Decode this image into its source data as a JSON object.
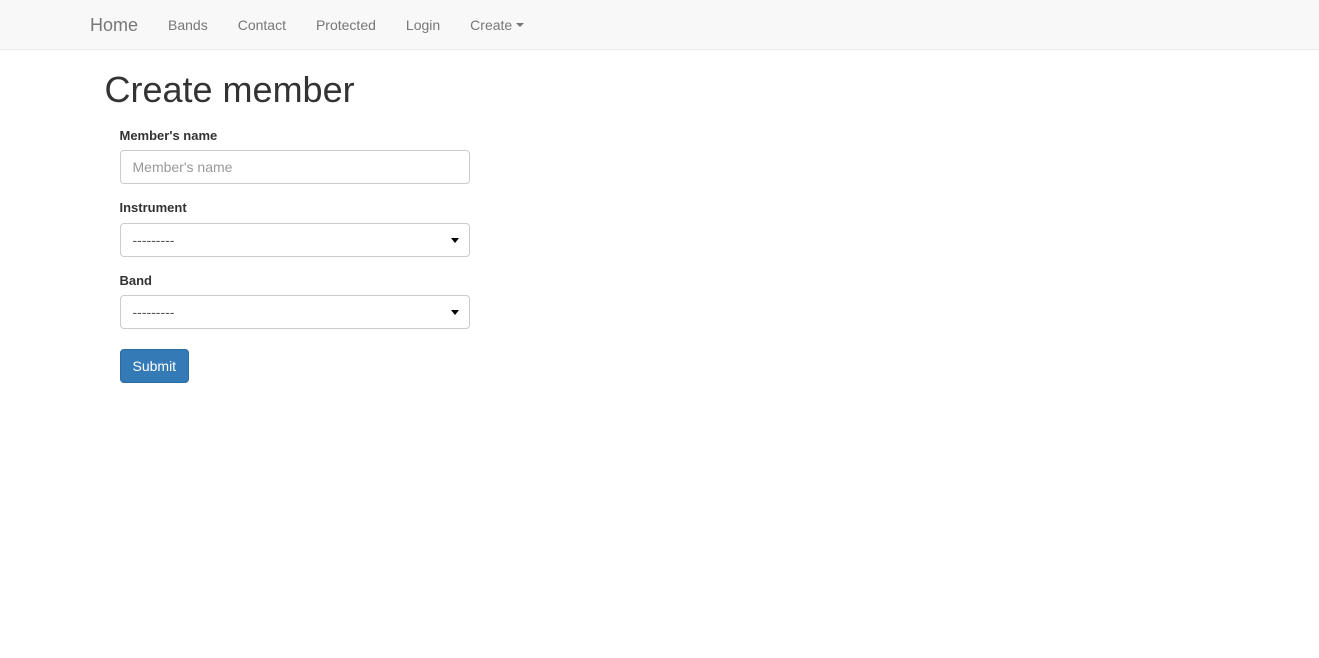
{
  "navbar": {
    "brand": {
      "label": "Home",
      "name": "navbar-brand-home"
    },
    "items": [
      {
        "label": "Bands",
        "name": "nav-item-bands",
        "caret": false
      },
      {
        "label": "Contact",
        "name": "nav-item-contact",
        "caret": false
      },
      {
        "label": "Protected",
        "name": "nav-item-protected",
        "caret": false
      },
      {
        "label": "Login",
        "name": "nav-item-login",
        "caret": false
      },
      {
        "label": "Create",
        "name": "nav-item-create",
        "caret": true
      }
    ],
    "background_color": "#f8f8f8",
    "border_color": "#e7e7e7",
    "link_color": "#777777"
  },
  "page": {
    "title": "Create member"
  },
  "form": {
    "fields": [
      {
        "label": "Member's name",
        "type": "text",
        "value": "",
        "placeholder": "Member's name"
      },
      {
        "label": "Instrument",
        "type": "select",
        "selected": "---------"
      },
      {
        "label": "Band",
        "type": "select",
        "selected": "---------"
      }
    ],
    "submit_label": "Submit",
    "submit_color": "#337ab7",
    "submit_border_color": "#2e6da4"
  }
}
